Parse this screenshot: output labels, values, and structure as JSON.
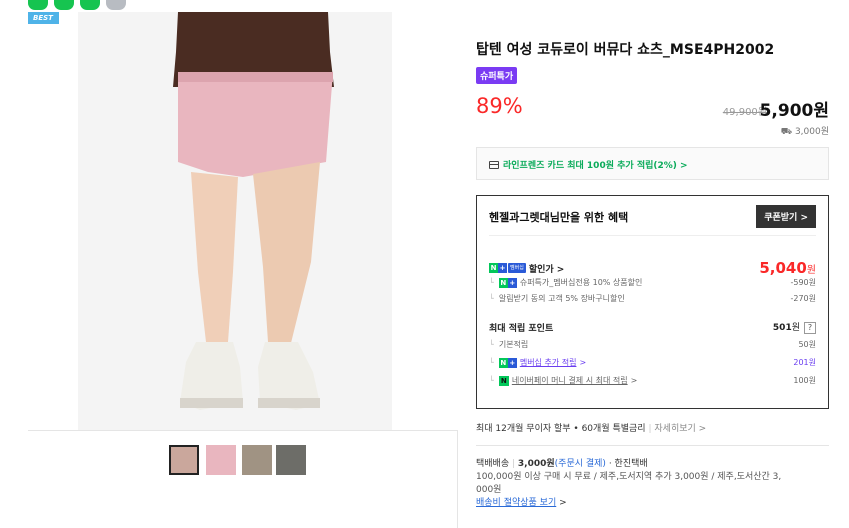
{
  "colors": {
    "accent_red": "#fa2828",
    "naver_green": "#03c75a",
    "badge_purple": "#7a3bf3",
    "best_blue": "#4fb3e8",
    "link_purple": "#6a3ef0"
  },
  "top_icons": [
    "green-icon",
    "green-icon",
    "green-icon",
    "gray-icon"
  ],
  "gallery": {
    "best_label": "BEST",
    "thumbnails": [
      {
        "color": "#caa79c",
        "selected": true
      },
      {
        "color": "#e9b6bf",
        "selected": false
      },
      {
        "color": "#a09383",
        "selected": false
      },
      {
        "color": "#6d6d68",
        "selected": false
      }
    ]
  },
  "product": {
    "title": "탑텐 여성 코듀로이 버뮤다 쇼츠_MSE4PH2002",
    "badge": "슈퍼특가",
    "discount_rate": "89%",
    "original_price": "49,900원",
    "final_price": "5,900원",
    "shipping": "3,000원"
  },
  "card_banner": {
    "text": "라인프렌즈 카드 최대 100원 추가 적립(2%) >"
  },
  "benefit": {
    "title": "헨젤과그렛대님만을 위한 혜택",
    "coupon_button": "쿠폰받기 >",
    "discount": {
      "label": "할인가 >",
      "membership_tag": "멤버십",
      "price_number": "5,040",
      "price_unit": "원",
      "items": [
        {
          "label": "슈퍼특가_멤버십전용 10% 상품할인",
          "value": "-590원"
        },
        {
          "label": "알림받기 동의 고객 5% 장바구니할인",
          "value": "-270원"
        }
      ]
    },
    "points": {
      "label": "최대 적립 포인트",
      "total_number": "501",
      "total_unit": "원",
      "help": "?",
      "items": [
        {
          "label": "기본적립",
          "value": "50원"
        },
        {
          "label": "멤버십 추가 적립",
          "arrow": ">",
          "value": "201원"
        },
        {
          "label": "네이버페이 머니 결제 시 최대 적립",
          "arrow": ">",
          "value": "100원"
        }
      ]
    }
  },
  "installment": {
    "text": "최대 12개월 무이자 할부 • 60개월 특별금리",
    "more": "자세히보기 >"
  },
  "delivery": {
    "type": "택배배송",
    "fee": "3,000원",
    "fee_note": "(주문시 결제)",
    "courier": "· 한진택배",
    "line2": "100,000원 이상 구매 시 무료 / 제주,도서지역 추가 3,000원 / 제주,도서산간 3,",
    "line3": "000원",
    "saving_link": "배송비 절약상품 보기",
    "saving_arrow": ">"
  }
}
